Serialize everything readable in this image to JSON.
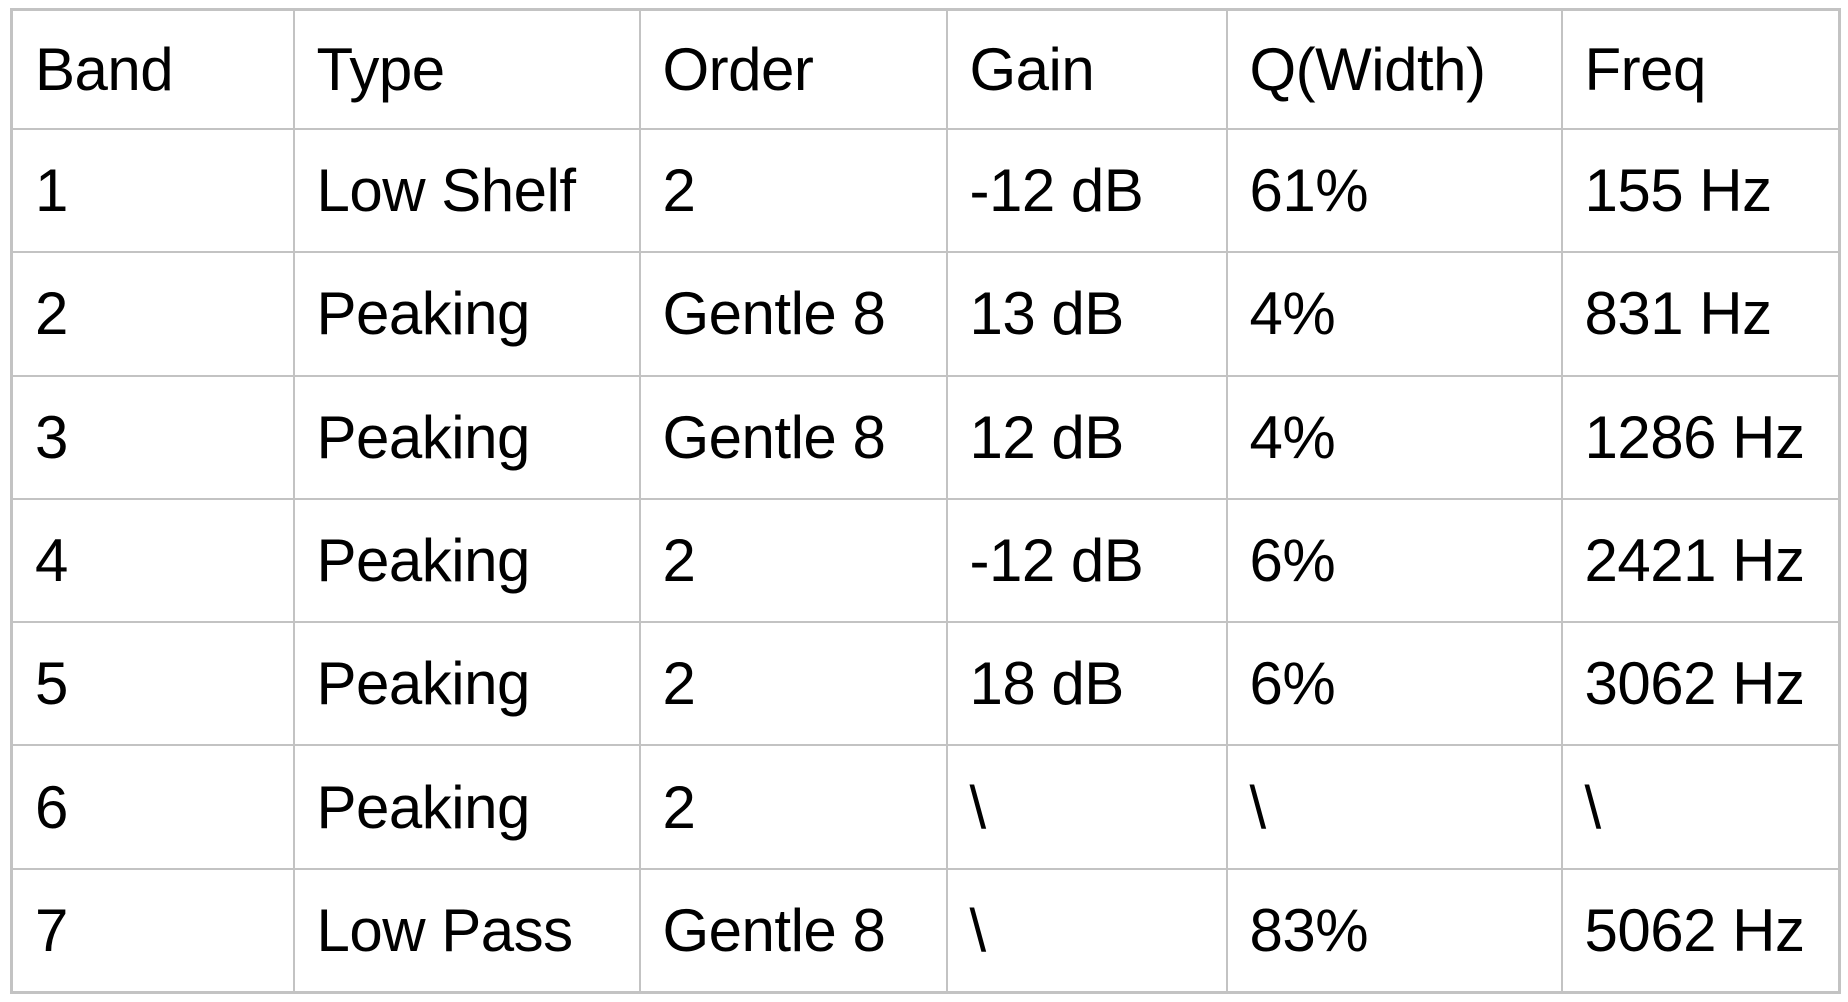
{
  "table": {
    "columns": [
      {
        "key": "band",
        "label": "Band"
      },
      {
        "key": "type",
        "label": "Type"
      },
      {
        "key": "order",
        "label": "Order"
      },
      {
        "key": "gain",
        "label": "Gain"
      },
      {
        "key": "q",
        "label": "Q(Width)"
      },
      {
        "key": "freq",
        "label": "Freq"
      }
    ],
    "rows": [
      {
        "band": "1",
        "type": "Low Shelf",
        "order": "2",
        "gain": "-12 dB",
        "q": "61%",
        "freq": "155 Hz"
      },
      {
        "band": "2",
        "type": "Peaking",
        "order": "Gentle 8",
        "gain": "13 dB",
        "q": "4%",
        "freq": "831 Hz"
      },
      {
        "band": "3",
        "type": "Peaking",
        "order": "Gentle 8",
        "gain": "12 dB",
        "q": "4%",
        "freq": "1286 Hz"
      },
      {
        "band": "4",
        "type": "Peaking",
        "order": "2",
        "gain": "-12 dB",
        "q": "6%",
        "freq": "2421 Hz"
      },
      {
        "band": "5",
        "type": "Peaking",
        "order": "2",
        "gain": "18 dB",
        "q": "6%",
        "freq": "3062 Hz"
      },
      {
        "band": "6",
        "type": "Peaking",
        "order": "2",
        "gain": "\\",
        "q": "\\",
        "freq": "\\"
      },
      {
        "band": "7",
        "type": "Low Pass",
        "order": "Gentle 8",
        "gain": "\\",
        "q": "83%",
        "freq": "5062 Hz"
      }
    ]
  },
  "style": {
    "border_color": "#c3c3c3",
    "text_color": "#000000",
    "background": "#ffffff"
  }
}
